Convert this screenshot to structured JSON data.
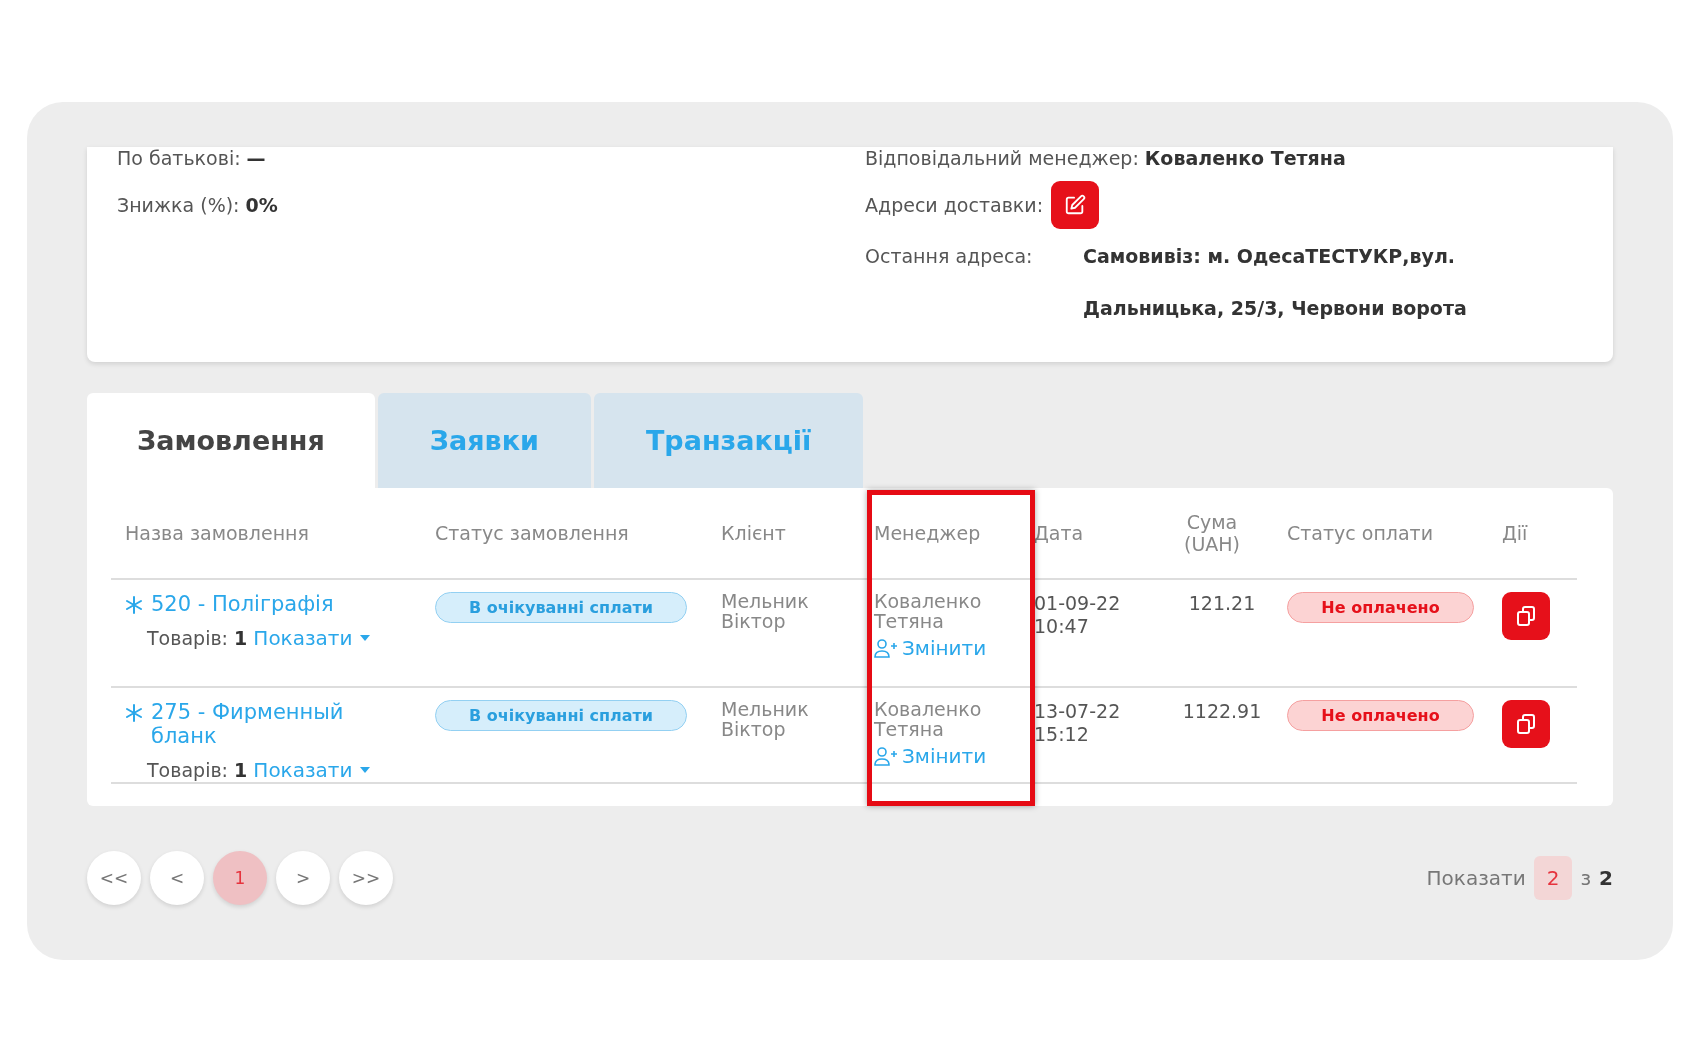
{
  "client_info": {
    "patronymic_label": "По батькові:",
    "patronymic_value": "—",
    "discount_label": "Знижка (%):",
    "discount_value": "0%",
    "manager_label": "Відповідальний менеджер:",
    "manager_value": "Коваленко Тетяна",
    "addresses_label": "Адреси доставки:",
    "last_address_label": "Остання адреса:",
    "last_address_lines": [
      "Самовивіз: м. ОдесаТЕСТУКР,вул.",
      "Дальницька, 25/3, Червони ворота"
    ]
  },
  "tabs": [
    {
      "label": "Замовлення",
      "selected": true
    },
    {
      "label": "Заявки",
      "selected": false
    },
    {
      "label": "Транзакції",
      "selected": false
    }
  ],
  "table": {
    "columns": [
      "Назва замовлення",
      "Статус замовлення",
      "Клієнт",
      "Менеджер",
      "Дата",
      "Сума (UAH)",
      "Статус оплати",
      "Дії"
    ],
    "rows": [
      {
        "name": "520 - Поліграфія",
        "products_label": "Товарів:",
        "products_count": "1",
        "show_label": "Показати",
        "status": "В очікуванні сплати",
        "client": "Мельник Віктор",
        "manager": "Коваленко Тетяна",
        "change_label": "Змінити",
        "date": "01-09-22 10:47",
        "sum": "121.21",
        "payment_status": "Не оплачено"
      },
      {
        "name": "275 - Фирменный бланк",
        "products_label": "Товарів:",
        "products_count": "1",
        "show_label": "Показати",
        "status": "В очікуванні сплати",
        "client": "Мельник Віктор",
        "manager": "Коваленко Тетяна",
        "change_label": "Змінити",
        "date": "13-07-22 15:12",
        "sum": "1122.91",
        "payment_status": "Не оплачено"
      }
    ]
  },
  "pagination": {
    "buttons": [
      {
        "label": "<<",
        "selected": false
      },
      {
        "label": "<",
        "selected": false
      },
      {
        "label": "1",
        "selected": true
      },
      {
        "label": ">",
        "selected": false
      },
      {
        "label": ">>",
        "selected": false
      }
    ],
    "show_label": "Показати",
    "per_page": "2",
    "of_label": "з",
    "total": "2"
  }
}
